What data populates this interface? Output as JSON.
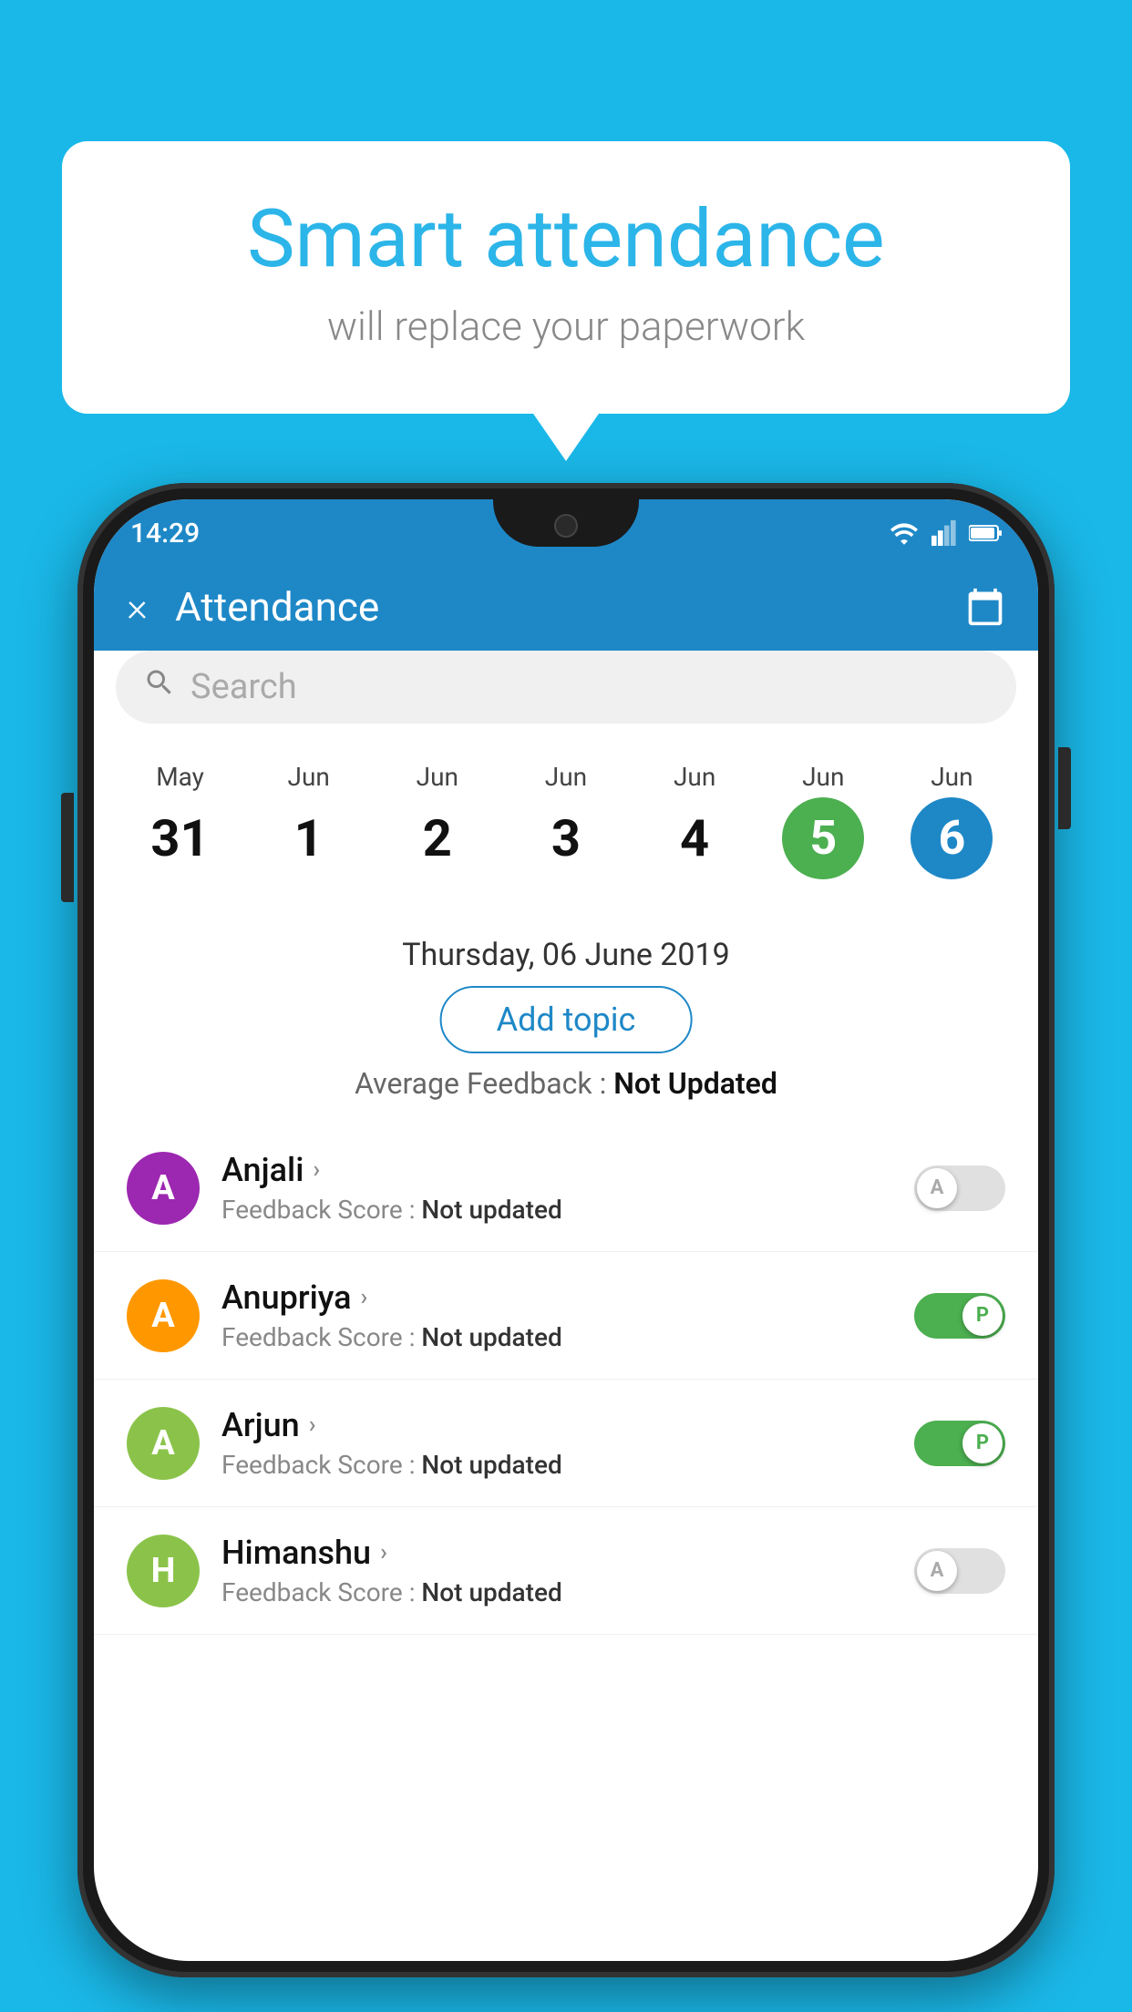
{
  "background_color": "#1ab8e8",
  "speech_bubble": {
    "title": "Smart attendance",
    "subtitle": "will replace your paperwork"
  },
  "phone": {
    "status_bar": {
      "time": "14:29",
      "icons": [
        "wifi",
        "signal",
        "battery"
      ]
    },
    "header": {
      "close_label": "×",
      "title": "Attendance",
      "calendar_icon": "calendar"
    },
    "search": {
      "placeholder": "Search"
    },
    "calendar": {
      "days": [
        {
          "month": "May",
          "date": "31",
          "state": "normal"
        },
        {
          "month": "Jun",
          "date": "1",
          "state": "normal"
        },
        {
          "month": "Jun",
          "date": "2",
          "state": "normal"
        },
        {
          "month": "Jun",
          "date": "3",
          "state": "normal"
        },
        {
          "month": "Jun",
          "date": "4",
          "state": "normal"
        },
        {
          "month": "Jun",
          "date": "5",
          "state": "today"
        },
        {
          "month": "Jun",
          "date": "6",
          "state": "selected"
        }
      ]
    },
    "selected_date_label": "Thursday, 06 June 2019",
    "add_topic_button": "Add topic",
    "avg_feedback_label": "Average Feedback : ",
    "avg_feedback_value": "Not Updated",
    "students": [
      {
        "name": "Anjali",
        "avatar_letter": "A",
        "avatar_color": "#9c27b0",
        "feedback_label": "Feedback Score : ",
        "feedback_value": "Not updated",
        "toggle_state": "off",
        "toggle_label": "A"
      },
      {
        "name": "Anupriya",
        "avatar_letter": "A",
        "avatar_color": "#ff9800",
        "feedback_label": "Feedback Score : ",
        "feedback_value": "Not updated",
        "toggle_state": "on",
        "toggle_label": "P"
      },
      {
        "name": "Arjun",
        "avatar_letter": "A",
        "avatar_color": "#8bc34a",
        "feedback_label": "Feedback Score : ",
        "feedback_value": "Not updated",
        "toggle_state": "on",
        "toggle_label": "P"
      },
      {
        "name": "Himanshu",
        "avatar_letter": "H",
        "avatar_color": "#8bc34a",
        "feedback_label": "Feedback Score : ",
        "feedback_value": "Not updated",
        "toggle_state": "off",
        "toggle_label": "A"
      }
    ]
  }
}
